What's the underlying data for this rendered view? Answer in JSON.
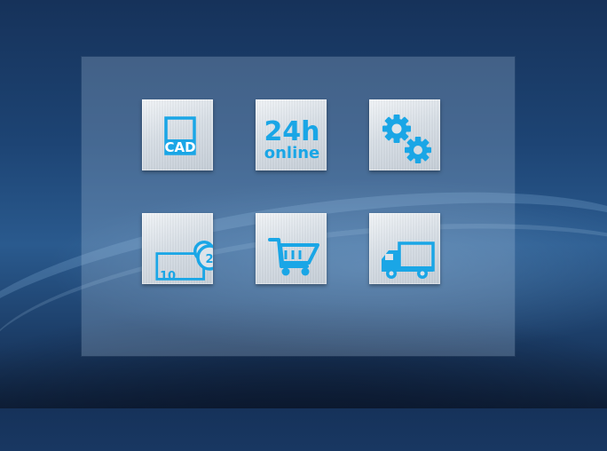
{
  "colors": {
    "accent": "#1aa6e6",
    "tile_light": "#eef2f6",
    "tile_dark": "#c6cfd8",
    "background": "#1d4474"
  },
  "tiles": [
    {
      "name": "cad",
      "icon": "cad-document-icon",
      "label": "CAD"
    },
    {
      "name": "online",
      "icon": "online-24h-icon",
      "line1": "24h",
      "line2": "online"
    },
    {
      "name": "settings",
      "icon": "gears-icon"
    },
    {
      "name": "coins",
      "icon": "banknote-coins-icon",
      "note": "10",
      "coin": "2"
    },
    {
      "name": "cart",
      "icon": "shopping-cart-icon"
    },
    {
      "name": "delivery",
      "icon": "delivery-truck-icon"
    }
  ]
}
